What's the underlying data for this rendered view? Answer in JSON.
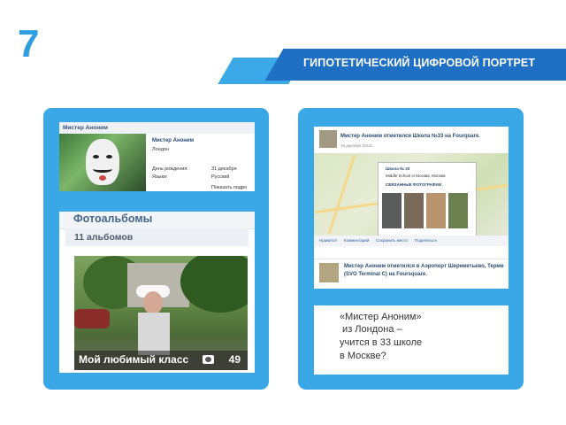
{
  "slide": {
    "number": "7",
    "title": "ГИПОТЕТИЧЕСКИЙ ЦИФРОВОЙ ПОРТРЕТ"
  },
  "colors": {
    "accent": "#1f6fc5",
    "light_accent": "#3aa8e7",
    "number": "#2e9ee0"
  },
  "profile": {
    "header_name": "Мистер Аноним",
    "name": "Мистер Аноним",
    "city": "Лондон",
    "birthday_label": "День рождения:",
    "birthday_value": "31 декабря",
    "language_label": "Языки:",
    "language_value": "Русский",
    "show_more": "Показать подро"
  },
  "photos": {
    "title": "Фотоальбомы",
    "count": "11 альбомов",
    "caption": "Мой любимый класс",
    "caption_count": "49",
    "icon": "camera-icon"
  },
  "foursquare": {
    "checkin1": "Мистер Аноним отметился Школа №33 на Fourquare.",
    "date1": "18 декабря 2012г.",
    "popup_title": "Школа № 33",
    "popup_line2": "Middle School in Москва, Москва",
    "popup_line3": "СВЯЗАННЫЕ ФОТОГРАФИИ",
    "links": [
      "Нравится",
      "Комментарий",
      "Сохранить место",
      "Поделиться"
    ],
    "checkin2_line1": "Мистер Аноним отметился в  Аэропорт Шереметьево, Терми",
    "checkin2_line2": "(SVO Terminal C) на Foursquare."
  },
  "quote": {
    "lines": [
      "«Мистер Аноним»",
      " из Лондона –",
      "учится в 33 школе",
      "в Москве?"
    ]
  }
}
